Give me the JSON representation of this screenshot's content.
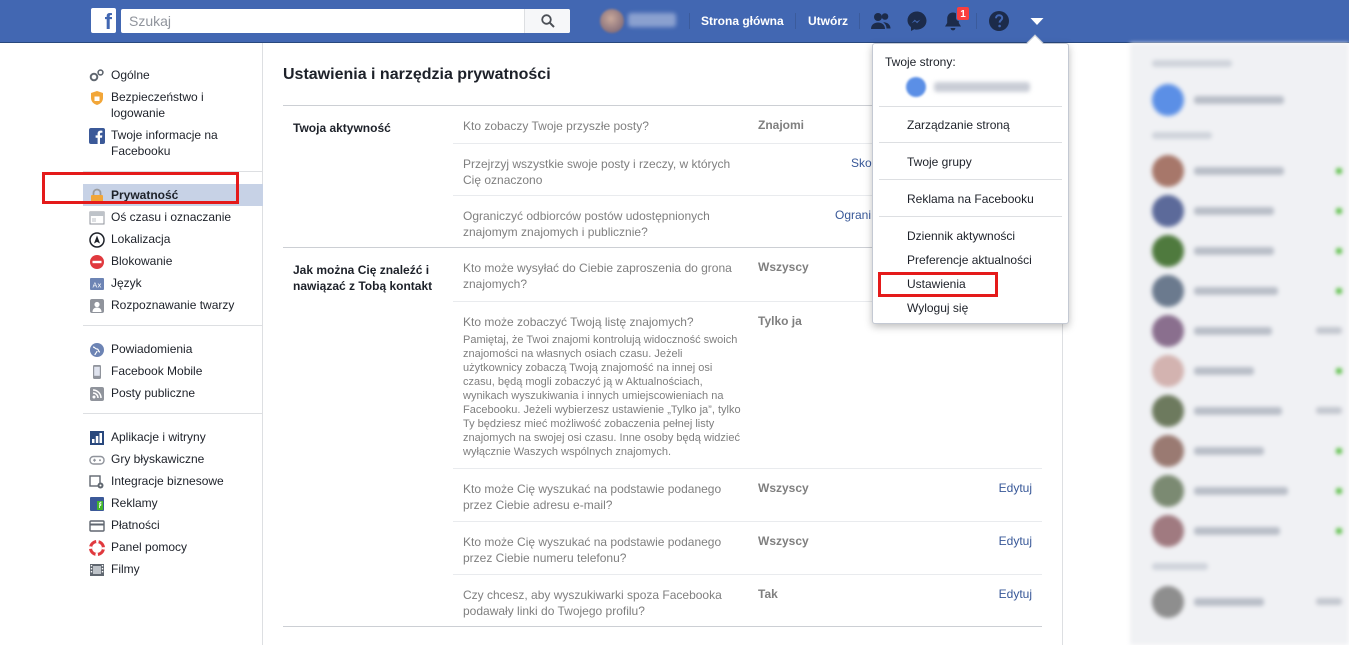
{
  "topbar": {
    "logo": "f",
    "search_placeholder": "Szukaj",
    "home_label": "Strona główna",
    "create_label": "Utwórz",
    "notification_count": "1",
    "icons": [
      "friends-icon",
      "messenger-icon",
      "bell-icon",
      "help-icon",
      "caret-down-icon"
    ]
  },
  "sidebar": {
    "groups": [
      [
        {
          "label": "Ogólne",
          "icon": "gears-icon"
        },
        {
          "label": "Bezpieczeństwo i logowanie",
          "icon": "shield-icon"
        },
        {
          "label": "Twoje informacje na Facebooku",
          "icon": "facebook-icon"
        }
      ],
      [
        {
          "label": "Prywatność",
          "icon": "lock-icon",
          "active": true
        },
        {
          "label": "Oś czasu i oznaczanie",
          "icon": "timeline-icon"
        },
        {
          "label": "Lokalizacja",
          "icon": "location-icon"
        },
        {
          "label": "Blokowanie",
          "icon": "block-icon"
        },
        {
          "label": "Język",
          "icon": "language-icon"
        },
        {
          "label": "Rozpoznawanie twarzy",
          "icon": "face-icon"
        }
      ],
      [
        {
          "label": "Powiadomienia",
          "icon": "globe-icon"
        },
        {
          "label": "Facebook Mobile",
          "icon": "mobile-icon"
        },
        {
          "label": "Posty publiczne",
          "icon": "rss-icon"
        }
      ],
      [
        {
          "label": "Aplikacje i witryny",
          "icon": "apps-icon"
        },
        {
          "label": "Gry błyskawiczne",
          "icon": "gamepad-icon"
        },
        {
          "label": "Integracje biznesowe",
          "icon": "business-icon"
        },
        {
          "label": "Reklamy",
          "icon": "ads-icon"
        },
        {
          "label": "Płatności",
          "icon": "card-icon"
        },
        {
          "label": "Panel pomocy",
          "icon": "lifebuoy-icon"
        },
        {
          "label": "Filmy",
          "icon": "film-icon"
        }
      ]
    ]
  },
  "main": {
    "title": "Ustawienia i narzędzia prywatności",
    "sections": [
      {
        "title": "Twoja aktywność",
        "rows": [
          {
            "question": "Kto zobaczy Twoje przyszłe posty?",
            "value": "Znajomi",
            "link": ""
          },
          {
            "question": "Przejrzyj wszystkie swoje posty i rzeczy, w których Cię oznaczono",
            "value": "",
            "link": "Sko"
          },
          {
            "question": "Ograniczyć odbiorców postów udostępnionych znajomym znajomych i publicznie?",
            "value": "",
            "link": "Ograni"
          }
        ]
      },
      {
        "title": "Jak można Cię znaleźć i nawiązać z Tobą kontakt",
        "rows": [
          {
            "question": "Kto może wysyłać do Ciebie zaproszenia do grona znajomych?",
            "value": "Wszyscy",
            "edit": ""
          },
          {
            "question": "Kto może zobaczyć Twoją listę znajomych?",
            "value": "Tylko ja",
            "edit": "",
            "note": "Pamiętaj, że Twoi znajomi kontrolują widoczność swoich znajomości na własnych osiach czasu. Jeżeli użytkownicy zobaczą Twoją znajomość na innej osi czasu, będą mogli zobaczyć ją w Aktualnościach, wynikach wyszukiwania i innych umiejscowieniach na Facebooku. Jeżeli wybierzesz ustawienie „Tylko ja”, tylko Ty będziesz mieć możliwość zobaczenia pełnej listy znajomych na swojej osi czasu. Inne osoby będą widzieć wyłącznie Waszych wspólnych znajomych."
          },
          {
            "question": "Kto może Cię wyszukać na podstawie podanego przez Ciebie adresu e-mail?",
            "value": "Wszyscy",
            "edit": "Edytuj"
          },
          {
            "question": "Kto może Cię wyszukać na podstawie podanego przez Ciebie numeru telefonu?",
            "value": "Wszyscy",
            "edit": "Edytuj"
          },
          {
            "question": "Czy chcesz, aby wyszukiwarki spoza Facebooka podawały linki do Twojego profilu?",
            "value": "Tak",
            "edit": "Edytuj"
          }
        ]
      }
    ]
  },
  "dropdown": {
    "pages_header": "Twoje strony:",
    "items": [
      "Zarządzanie stroną",
      "Twoje grupy",
      "Reklama na Facebooku",
      "Dziennik aktywności",
      "Preferencje aktualności",
      "Ustawienia",
      "Wyloguj się"
    ]
  },
  "colors": {
    "brand": "#4267b2",
    "link": "#385898",
    "highlight_box": "#e41a1a",
    "active_nav": "#c7d2e6"
  }
}
